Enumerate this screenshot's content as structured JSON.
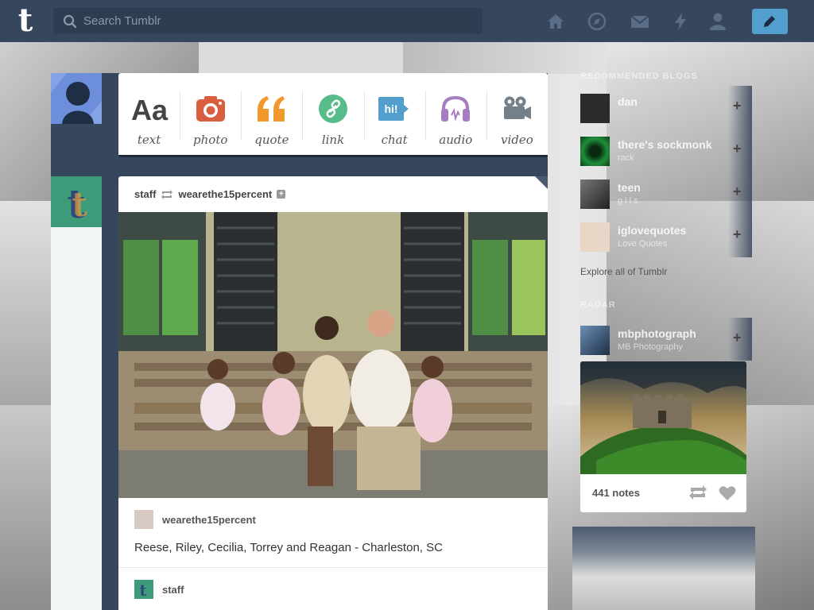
{
  "topbar": {
    "search_placeholder": "Search Tumblr",
    "nav_icons": [
      "home-icon",
      "explore-compass-icon",
      "inbox-mail-icon",
      "activity-lightning-icon",
      "account-person-icon"
    ],
    "compose_icon": "pencil-icon",
    "colors": {
      "bar": "#36465d",
      "search": "#2e3d52",
      "compose": "#529ecc"
    }
  },
  "post_types": [
    {
      "label": "text",
      "icon": "text-aa-icon",
      "color": "#444444"
    },
    {
      "label": "photo",
      "icon": "camera-icon",
      "color": "#d95e40"
    },
    {
      "label": "quote",
      "icon": "quote-icon",
      "color": "#f2992e"
    },
    {
      "label": "link",
      "icon": "link-icon",
      "color": "#56bc8a"
    },
    {
      "label": "chat",
      "icon": "chat-bubble-icon",
      "color": "#529ecc"
    },
    {
      "label": "audio",
      "icon": "headphones-icon",
      "color": "#a77dc2"
    },
    {
      "label": "video",
      "icon": "video-camera-icon",
      "color": "#748089"
    }
  ],
  "post": {
    "reblogger": "staff",
    "source": "wearethe15percent",
    "source_name": "wearethe15percent",
    "caption": "Reese, Riley, Cecilia, Torrey and Reagan - Charleston, SC",
    "reblog_name": "staff"
  },
  "sidebar": {
    "recommended_heading": "Recommended Blogs",
    "recommended": [
      {
        "name": "dan",
        "sub": "",
        "avatar_color": "#2b2b2b"
      },
      {
        "name": "there's sockmonk",
        "sub": "rack",
        "avatar_color": "#1f8f3a"
      },
      {
        "name": "teen",
        "sub": "g i l s",
        "avatar_color": "#3a3a3a"
      },
      {
        "name": "iglovequotes",
        "sub": "Love Quotes",
        "avatar_color": "#e8d6c6"
      }
    ],
    "explore_label": "Explore all of Tumblr",
    "radar_heading": "Radar",
    "radar_blog": {
      "name": "mbphotograph",
      "sub": "MB Photography",
      "avatar_color": "#3d5a7a"
    },
    "radar_notes": "441 notes"
  }
}
